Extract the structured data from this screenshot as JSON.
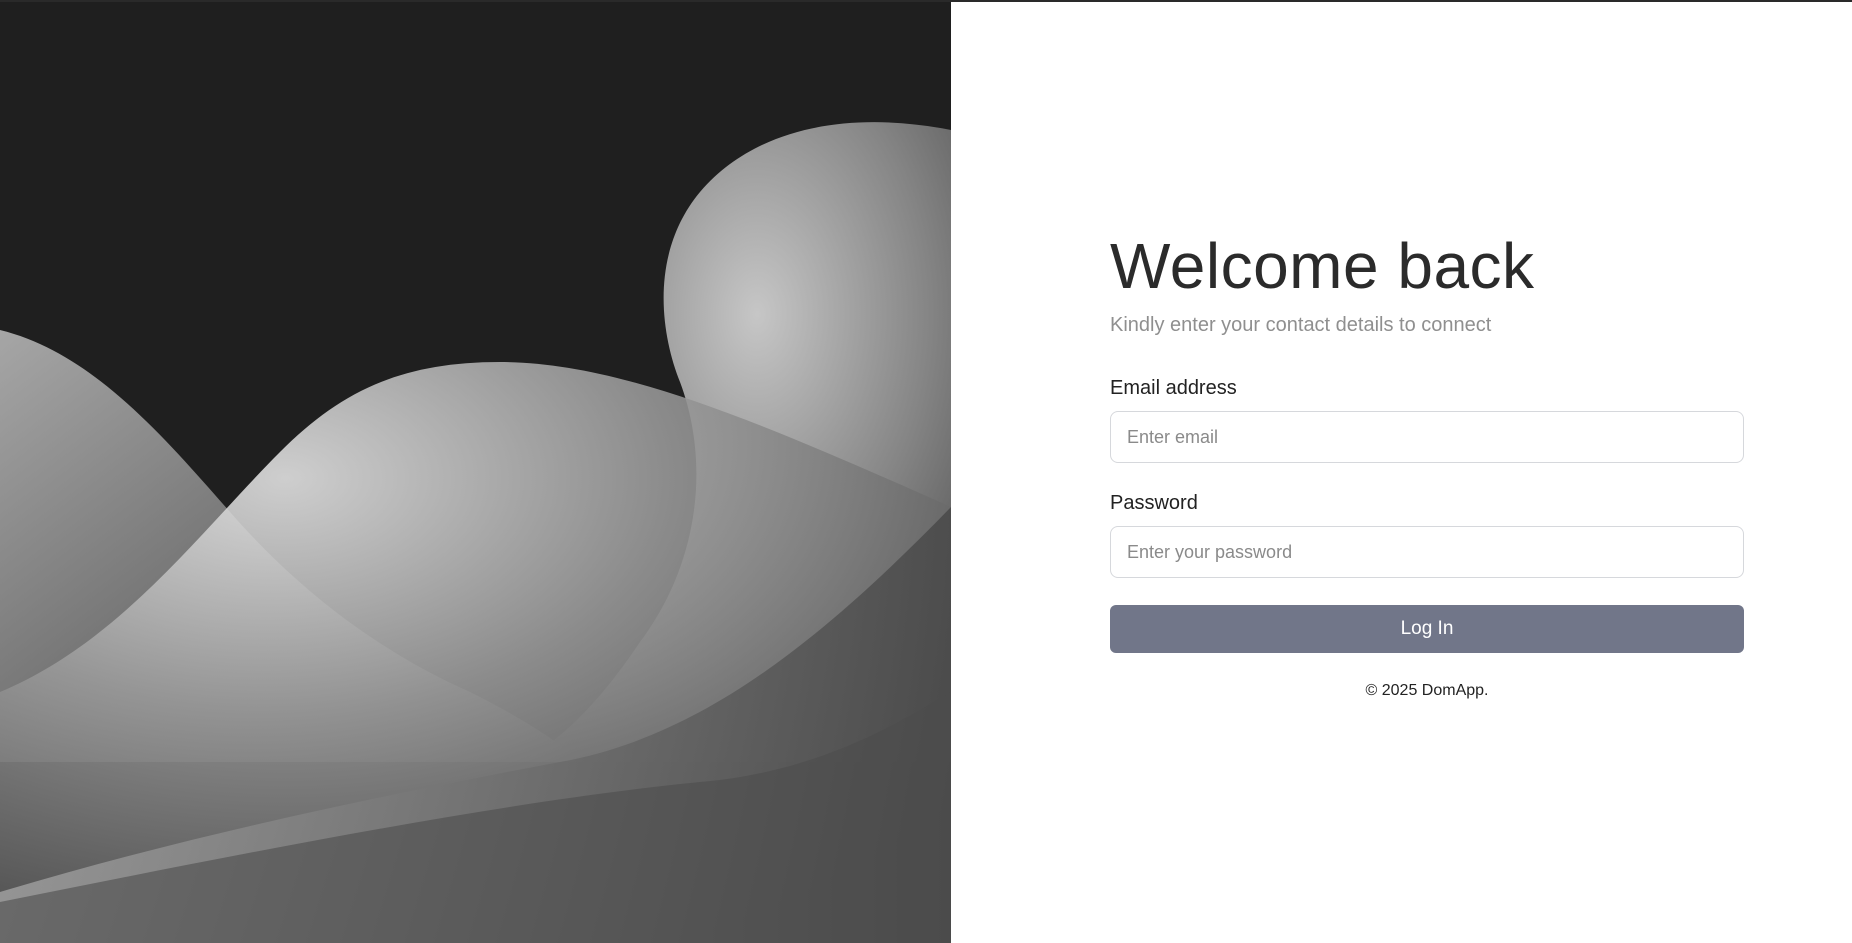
{
  "login": {
    "title": "Welcome back",
    "subtitle": "Kindly enter your contact details to connect",
    "email_label": "Email address",
    "email_placeholder": "Enter email",
    "email_value": "",
    "password_label": "Password",
    "password_placeholder": "Enter your password",
    "password_value": "",
    "submit_label": "Log In",
    "footer_text": "© 2025 DomApp."
  },
  "colors": {
    "hero_background": "#1f1f1f",
    "button_background": "#717689",
    "title_text": "#2b2b2b",
    "subtitle_text": "#8f8f8f"
  }
}
